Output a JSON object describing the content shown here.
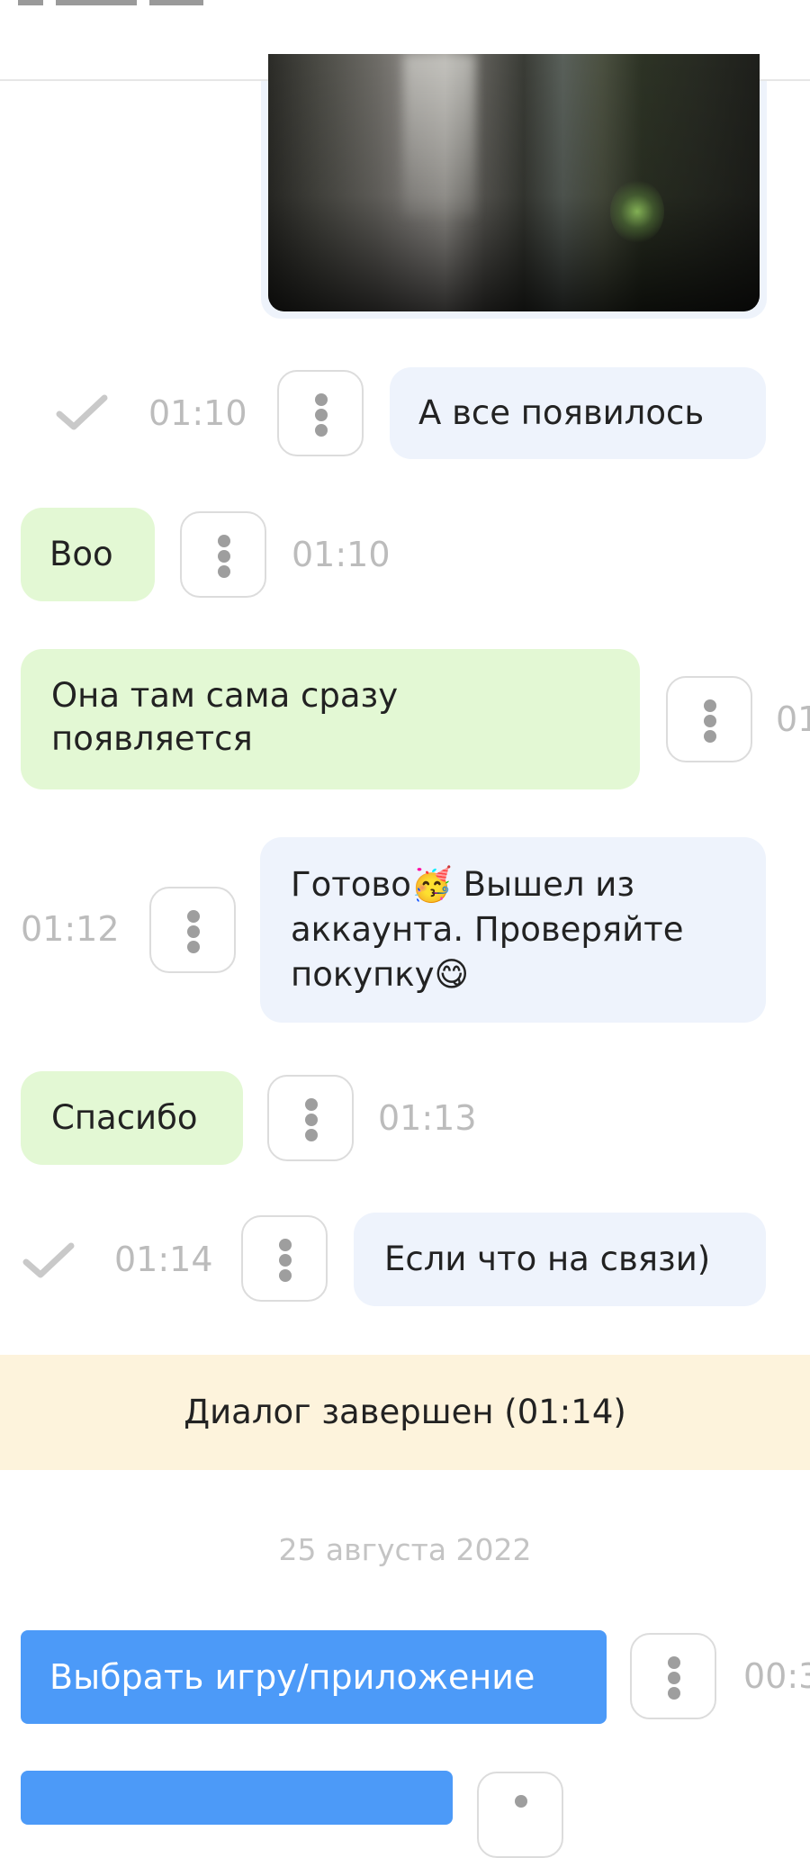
{
  "messages": [
    {
      "text": "А все появилось",
      "time": "01:10"
    },
    {
      "text": "Воо",
      "time": "01:10"
    },
    {
      "text": "Она там сама сразу появляется",
      "time": "01"
    },
    {
      "text": "Готово🥳 Вышел из аккаунта. Проверяйте покупку😋",
      "time": "01:12"
    },
    {
      "text": "Спасибо",
      "time": "01:13"
    },
    {
      "text": "Если что на связи)",
      "time": "01:14"
    }
  ],
  "banner": {
    "text": "Диалог завершен (01:14)"
  },
  "date_separator": "25 августа 2022",
  "actions": [
    {
      "label": "Выбрать игру/приложение",
      "time": "00:3"
    }
  ],
  "colors": {
    "outgoing_bubble": "#eef3fc",
    "incoming_bubble": "#e3f8d4",
    "action_button": "#4c9af8",
    "banner": "#fdf3dc",
    "timestamp": "#bcbcbc"
  },
  "icons": {
    "menu": "vertical-dots-icon",
    "delivered": "checkmark-icon"
  }
}
